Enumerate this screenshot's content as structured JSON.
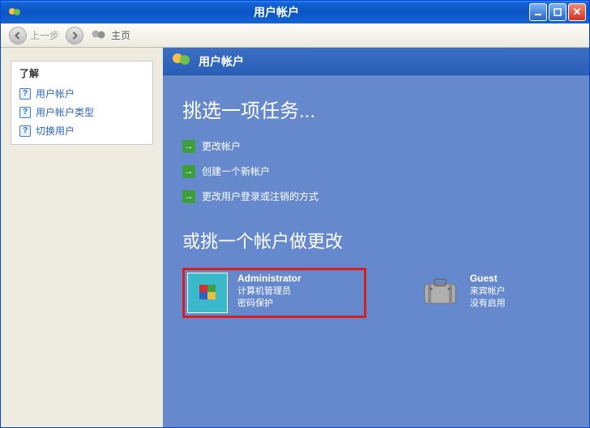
{
  "titlebar": {
    "title": "用户帐户"
  },
  "toolbar": {
    "back": "上一步",
    "home": "主页"
  },
  "sidebar": {
    "learn_title": "了解",
    "items": [
      "用户帐户",
      "用户帐户类型",
      "切换用户"
    ]
  },
  "header": {
    "title": "用户帐户"
  },
  "main": {
    "pick_task": "挑选一项任务...",
    "tasks": [
      "更改帐户",
      "创建一个新帐户",
      "更改用户登录或注销的方式"
    ],
    "pick_account": "或挑一个帐户做更改"
  },
  "accounts": [
    {
      "name": "Administrator",
      "line1": "计算机管理员",
      "line2": "密码保护"
    },
    {
      "name": "Guest",
      "line1": "来宾帐户没有启用",
      "line2": ""
    }
  ]
}
